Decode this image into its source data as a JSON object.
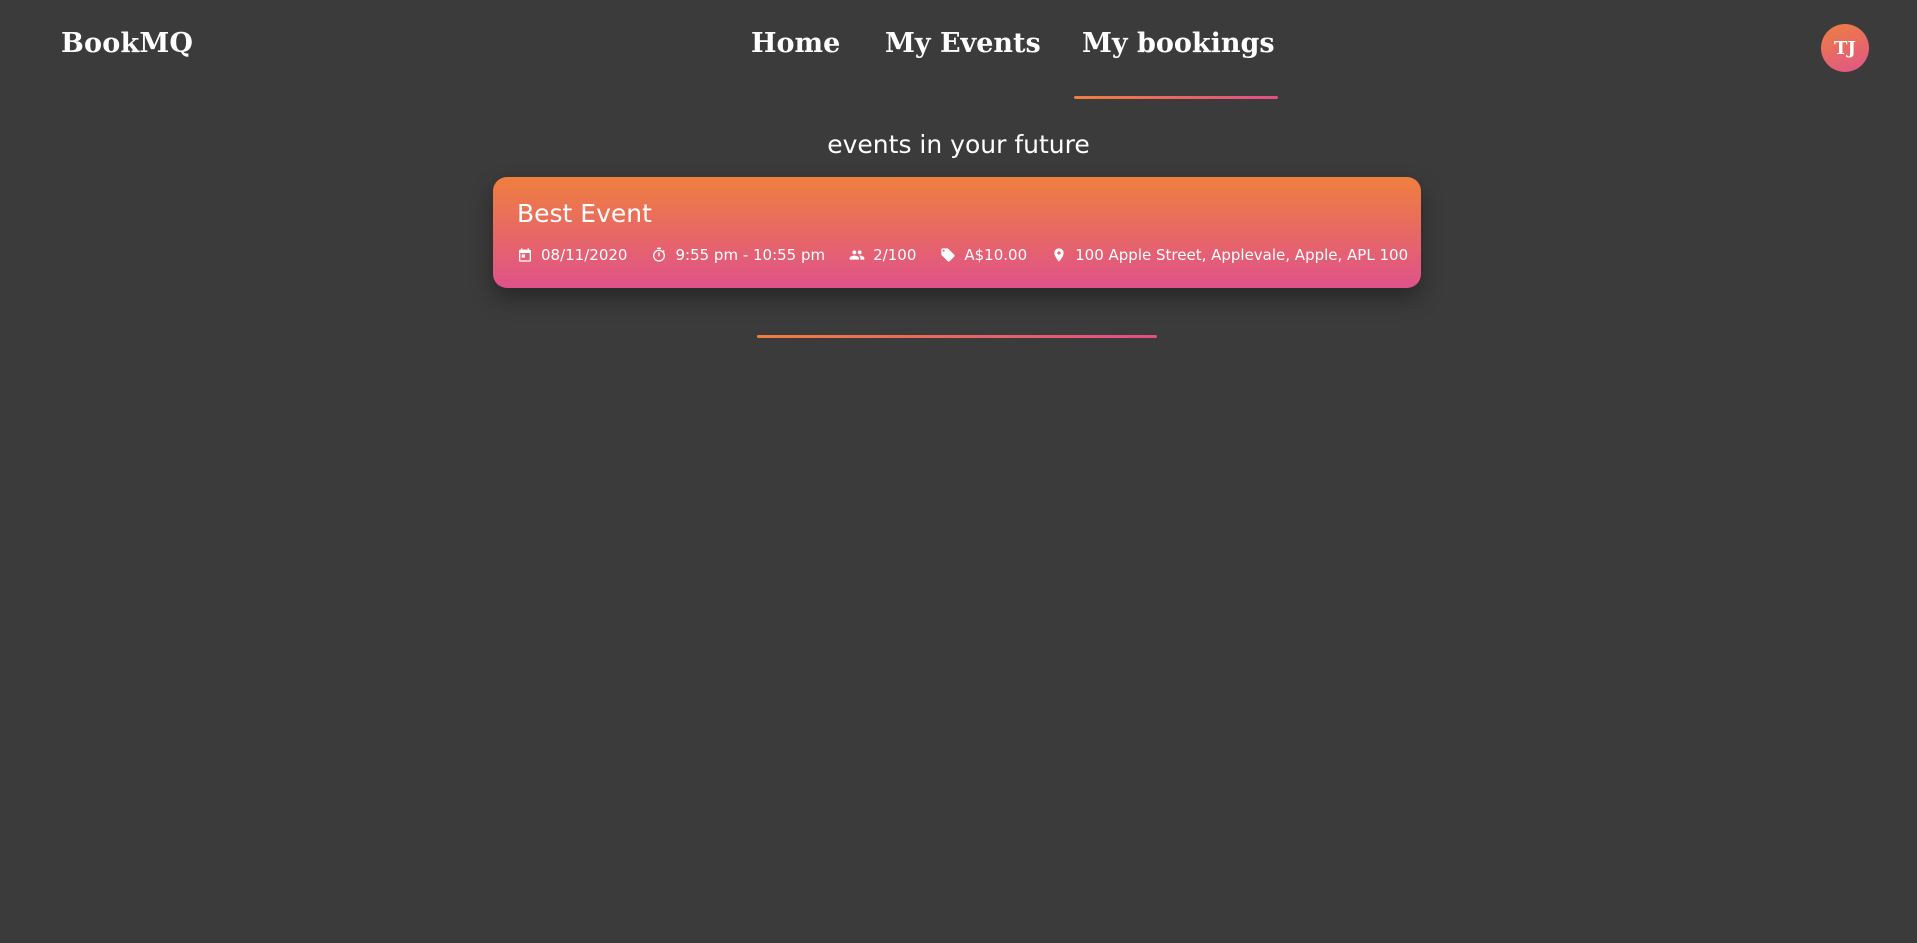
{
  "app": {
    "brand": "BookMQ",
    "avatar_initials": "TJ"
  },
  "nav": {
    "items": [
      {
        "label": "Home",
        "active": false
      },
      {
        "label": "My Events",
        "active": false
      },
      {
        "label": "My bookings",
        "active": true
      }
    ]
  },
  "main": {
    "section_title": "events in your future",
    "events": [
      {
        "title": "Best Event",
        "date": "08/11/2020",
        "time": "9:55 pm - 10:55 pm",
        "attendance": "2/100",
        "price": "A$10.00",
        "location": "100 Apple Street, Applevale, Apple, APL 100"
      }
    ]
  },
  "theme": {
    "background": "#3b3b3b",
    "accent_start": "#ef7f3e",
    "accent_end": "#e0528a",
    "text": "#ffffff"
  },
  "icons": {
    "date": "calendar-icon",
    "time": "timer-icon",
    "attendance": "people-icon",
    "price": "tag-icon",
    "location": "location-pin-icon"
  }
}
